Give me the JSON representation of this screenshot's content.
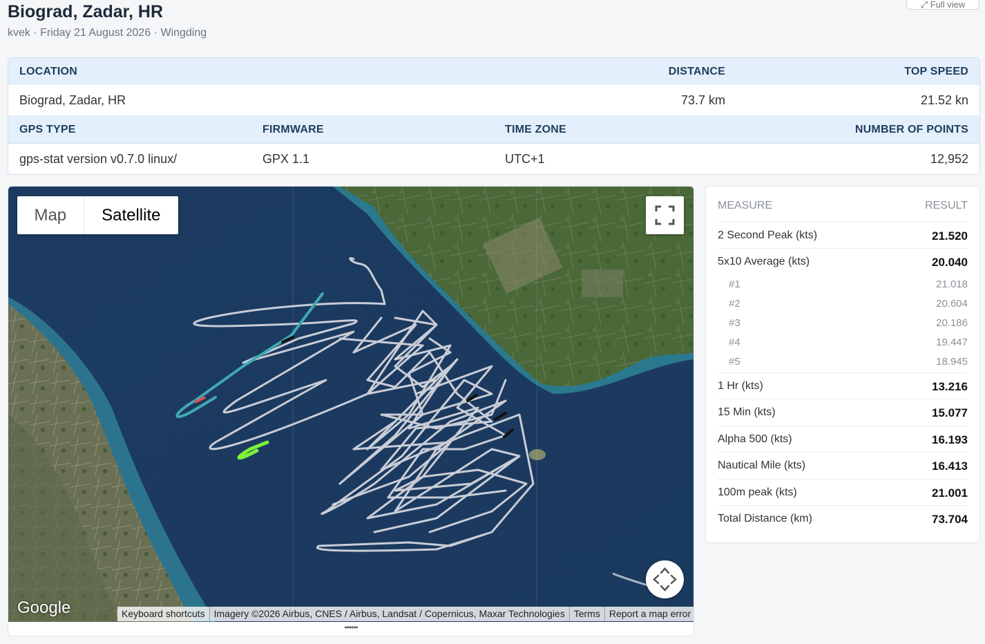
{
  "page": {
    "title": "Biograd, Zadar, HR",
    "subtitle": "kvek · Friday 21 August 2026 · Wingding",
    "full_view_label": "⤢ Full view"
  },
  "info": {
    "headers1": {
      "location": "LOCATION",
      "distance": "DISTANCE",
      "top_speed": "TOP SPEED"
    },
    "values1": {
      "location": "Biograd, Zadar, HR",
      "distance": "73.7 km",
      "top_speed": "21.52 kn"
    },
    "headers2": {
      "gps_type": "GPS TYPE",
      "firmware": "FIRMWARE",
      "time_zone": "TIME ZONE",
      "points": "NUMBER OF POINTS"
    },
    "values2": {
      "gps_type": "gps-stat version v0.7.0 linux/",
      "firmware": "GPX 1.1",
      "time_zone": "UTC+1",
      "points": "12,952"
    }
  },
  "map": {
    "map_label": "Map",
    "satellite_label": "Satellite",
    "selected_type": "Satellite",
    "google_label": "Google",
    "attribution": {
      "shortcuts": "Keyboard shortcuts",
      "imagery": "Imagery ©2026 Airbus, CNES / Airbus, Landsat / Copernicus, Maxar Technologies",
      "terms": "Terms",
      "report": "Report a map error"
    },
    "grip": "••••••",
    "track_color": "#c9cdd6",
    "highlight_color_teal": "#3fa9b4",
    "highlight_color_green": "#7cf23a",
    "sea_color": "#1e3f66",
    "land_color": "#4d6b3c",
    "icons": [
      "fullscreen-icon",
      "pan-control-icon"
    ]
  },
  "measures": {
    "header": {
      "measure": "MEASURE",
      "result": "RESULT"
    },
    "rows": [
      {
        "label": "2 Second Peak (kts)",
        "result": "21.520"
      },
      {
        "label": "5x10 Average (kts)",
        "result": "20.040"
      },
      {
        "label": "1 Hr (kts)",
        "result": "13.216"
      },
      {
        "label": "15 Min (kts)",
        "result": "15.077"
      },
      {
        "label": "Alpha 500 (kts)",
        "result": "16.193"
      },
      {
        "label": "Nautical Mile (kts)",
        "result": "16.413"
      },
      {
        "label": "100m peak (kts)",
        "result": "21.001"
      },
      {
        "label": "Total Distance (km)",
        "result": "73.704"
      }
    ],
    "sub_rows": [
      {
        "label": "#1",
        "result": "21.018"
      },
      {
        "label": "#2",
        "result": "20.604"
      },
      {
        "label": "#3",
        "result": "20.186"
      },
      {
        "label": "#4",
        "result": "19.447"
      },
      {
        "label": "#5",
        "result": "18.945"
      }
    ]
  }
}
